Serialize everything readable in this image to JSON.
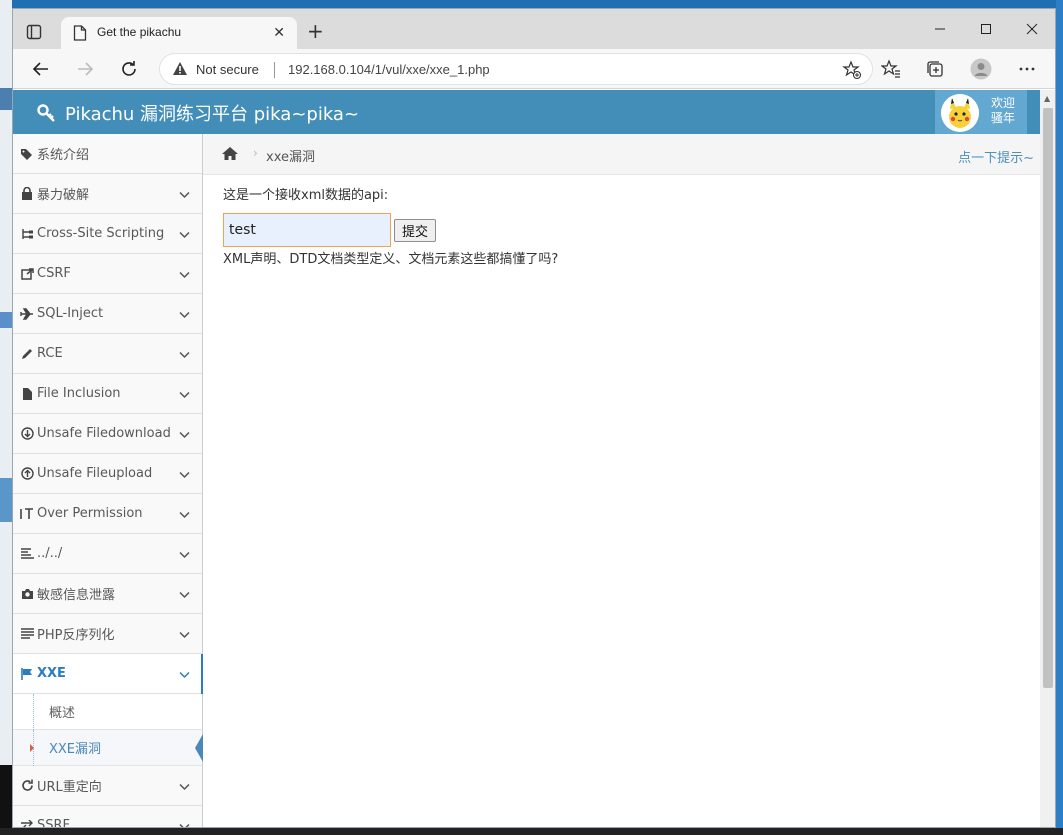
{
  "browser": {
    "tab_title": "Get the pikachu",
    "security_label": "Not secure",
    "url": "192.168.0.104/1/vul/xxe/xxe_1.php"
  },
  "header": {
    "title": "Pikachu 漏洞练习平台 pika~pika~",
    "welcome": "欢迎",
    "username": "骚年"
  },
  "sidebar": {
    "items": [
      {
        "label": "系统介绍",
        "icon": "tags-icon"
      },
      {
        "label": "暴力破解",
        "icon": "lock-icon"
      },
      {
        "label": "Cross-Site Scripting",
        "icon": "sitemap-icon"
      },
      {
        "label": "CSRF",
        "icon": "share-icon"
      },
      {
        "label": "SQL-Inject",
        "icon": "plane-icon"
      },
      {
        "label": "RCE",
        "icon": "pencil-icon"
      },
      {
        "label": "File Inclusion",
        "icon": "file-icon"
      },
      {
        "label": "Unsafe Filedownload",
        "icon": "download-icon"
      },
      {
        "label": "Unsafe Fileupload",
        "icon": "upload-icon"
      },
      {
        "label": "Over Permission",
        "icon": "text-icon"
      },
      {
        "label": "../../",
        "icon": "list-icon"
      },
      {
        "label": "敏感信息泄露",
        "icon": "camera-icon"
      },
      {
        "label": "PHP反序列化",
        "icon": "list-icon"
      },
      {
        "label": "XXE",
        "icon": "flag-icon"
      },
      {
        "label": "URL重定向",
        "icon": "repeat-icon"
      },
      {
        "label": "SSRF",
        "icon": "exchange-icon"
      }
    ],
    "xxe_sub": [
      {
        "label": "概述"
      },
      {
        "label": "XXE漏洞"
      }
    ]
  },
  "breadcrumbs": {
    "current": "xxe漏洞",
    "hint": "点一下提示~"
  },
  "content": {
    "prompt": "这是一个接收xml数据的api:",
    "input_value": "test",
    "submit_label": "提交",
    "note": "XML声明、DTD文档类型定义、文档元素这些都搞懂了吗?"
  },
  "colors": {
    "header": "#438eb9",
    "accent": "#2b7dbc",
    "input_border": "#f0a354"
  }
}
